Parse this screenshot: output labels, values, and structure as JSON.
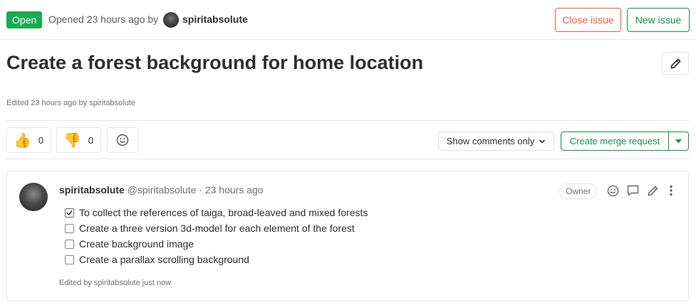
{
  "header": {
    "status": "Open",
    "opened_text": "Opened 23 hours ago by",
    "author": "spiritabsolute",
    "close_issue_label": "Close issue",
    "new_issue_label": "New issue"
  },
  "issue": {
    "title": "Create a forest background for home location",
    "edited_text": "Edited 23 hours ago by spiritabsolute"
  },
  "awards": {
    "thumbs_up_count": "0",
    "thumbs_down_count": "0"
  },
  "toolbar": {
    "comments_filter_label": "Show comments only",
    "create_merge_request_label": "Create merge request"
  },
  "note": {
    "author_name": "spiritabsolute",
    "author_meta": "@spiritabsolute · 23 hours ago",
    "role_badge": "Owner",
    "tasks": [
      {
        "label": "To collect the references of taiga, broad-leaved and mixed forests",
        "checked": true
      },
      {
        "label": "Create a three version 3d-model for each element of the forest",
        "checked": false
      },
      {
        "label": "Create background image",
        "checked": false
      },
      {
        "label": "Create a parallax scrolling background",
        "checked": false
      }
    ],
    "edited_text": "Edited by spiritabsolute just now"
  },
  "colors": {
    "open_badge": "#1aaa55",
    "close_issue": "#e75e40",
    "success": "#168f48"
  },
  "icons": {
    "pencil": "pencil-icon",
    "thumbs_up": "thumbs-up-icon",
    "thumbs_down": "thumbs-down-icon",
    "smiley": "smiley-icon",
    "chevron": "chevron-down-icon",
    "comment": "comment-icon",
    "more": "kebab-icon",
    "checkmark": "checkmark-icon"
  }
}
